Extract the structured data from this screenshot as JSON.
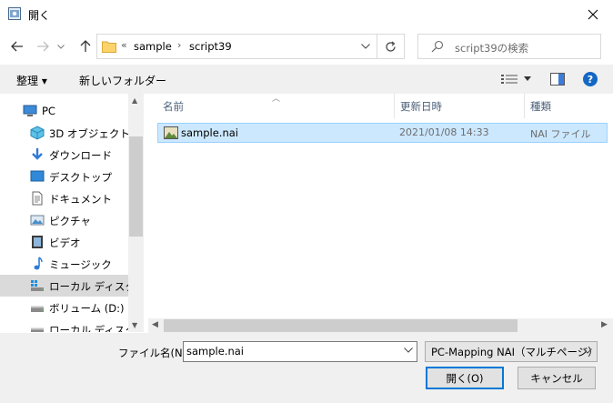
{
  "window": {
    "title": "開く"
  },
  "address": {
    "overflow": "«",
    "segments": [
      "sample",
      "script39"
    ],
    "separator": "›"
  },
  "search": {
    "placeholder": "script39の検索"
  },
  "toolbar": {
    "organize": "整理 ▾",
    "new_folder": "新しいフォルダー"
  },
  "nav": {
    "items": [
      {
        "label": "PC",
        "icon": "pc-icon"
      },
      {
        "label": "3D オブジェクト",
        "icon": "3d-objects-icon"
      },
      {
        "label": "ダウンロード",
        "icon": "download-icon"
      },
      {
        "label": "デスクトップ",
        "icon": "desktop-icon"
      },
      {
        "label": "ドキュメント",
        "icon": "document-icon"
      },
      {
        "label": "ピクチャ",
        "icon": "picture-icon"
      },
      {
        "label": "ビデオ",
        "icon": "video-icon"
      },
      {
        "label": "ミュージック",
        "icon": "music-icon"
      },
      {
        "label": "ローカル ディスク (C",
        "icon": "drive-icon"
      },
      {
        "label": "ボリューム (D:)",
        "icon": "drive-icon"
      },
      {
        "label": "ローカル ディスク (E",
        "icon": "drive-icon"
      }
    ]
  },
  "columns": {
    "name": "名前",
    "modified": "更新日時",
    "type": "種類"
  },
  "files": [
    {
      "name": "sample.nai",
      "modified": "2021/01/08 14:33",
      "type": "NAI ファイル"
    }
  ],
  "footer": {
    "filename_label": "ファイル名(N):",
    "filename_value": "sample.nai",
    "filetype": "PC-Mapping NAI（マルチページ）",
    "open_label": "開く(O)",
    "cancel_label": "キャンセル"
  }
}
